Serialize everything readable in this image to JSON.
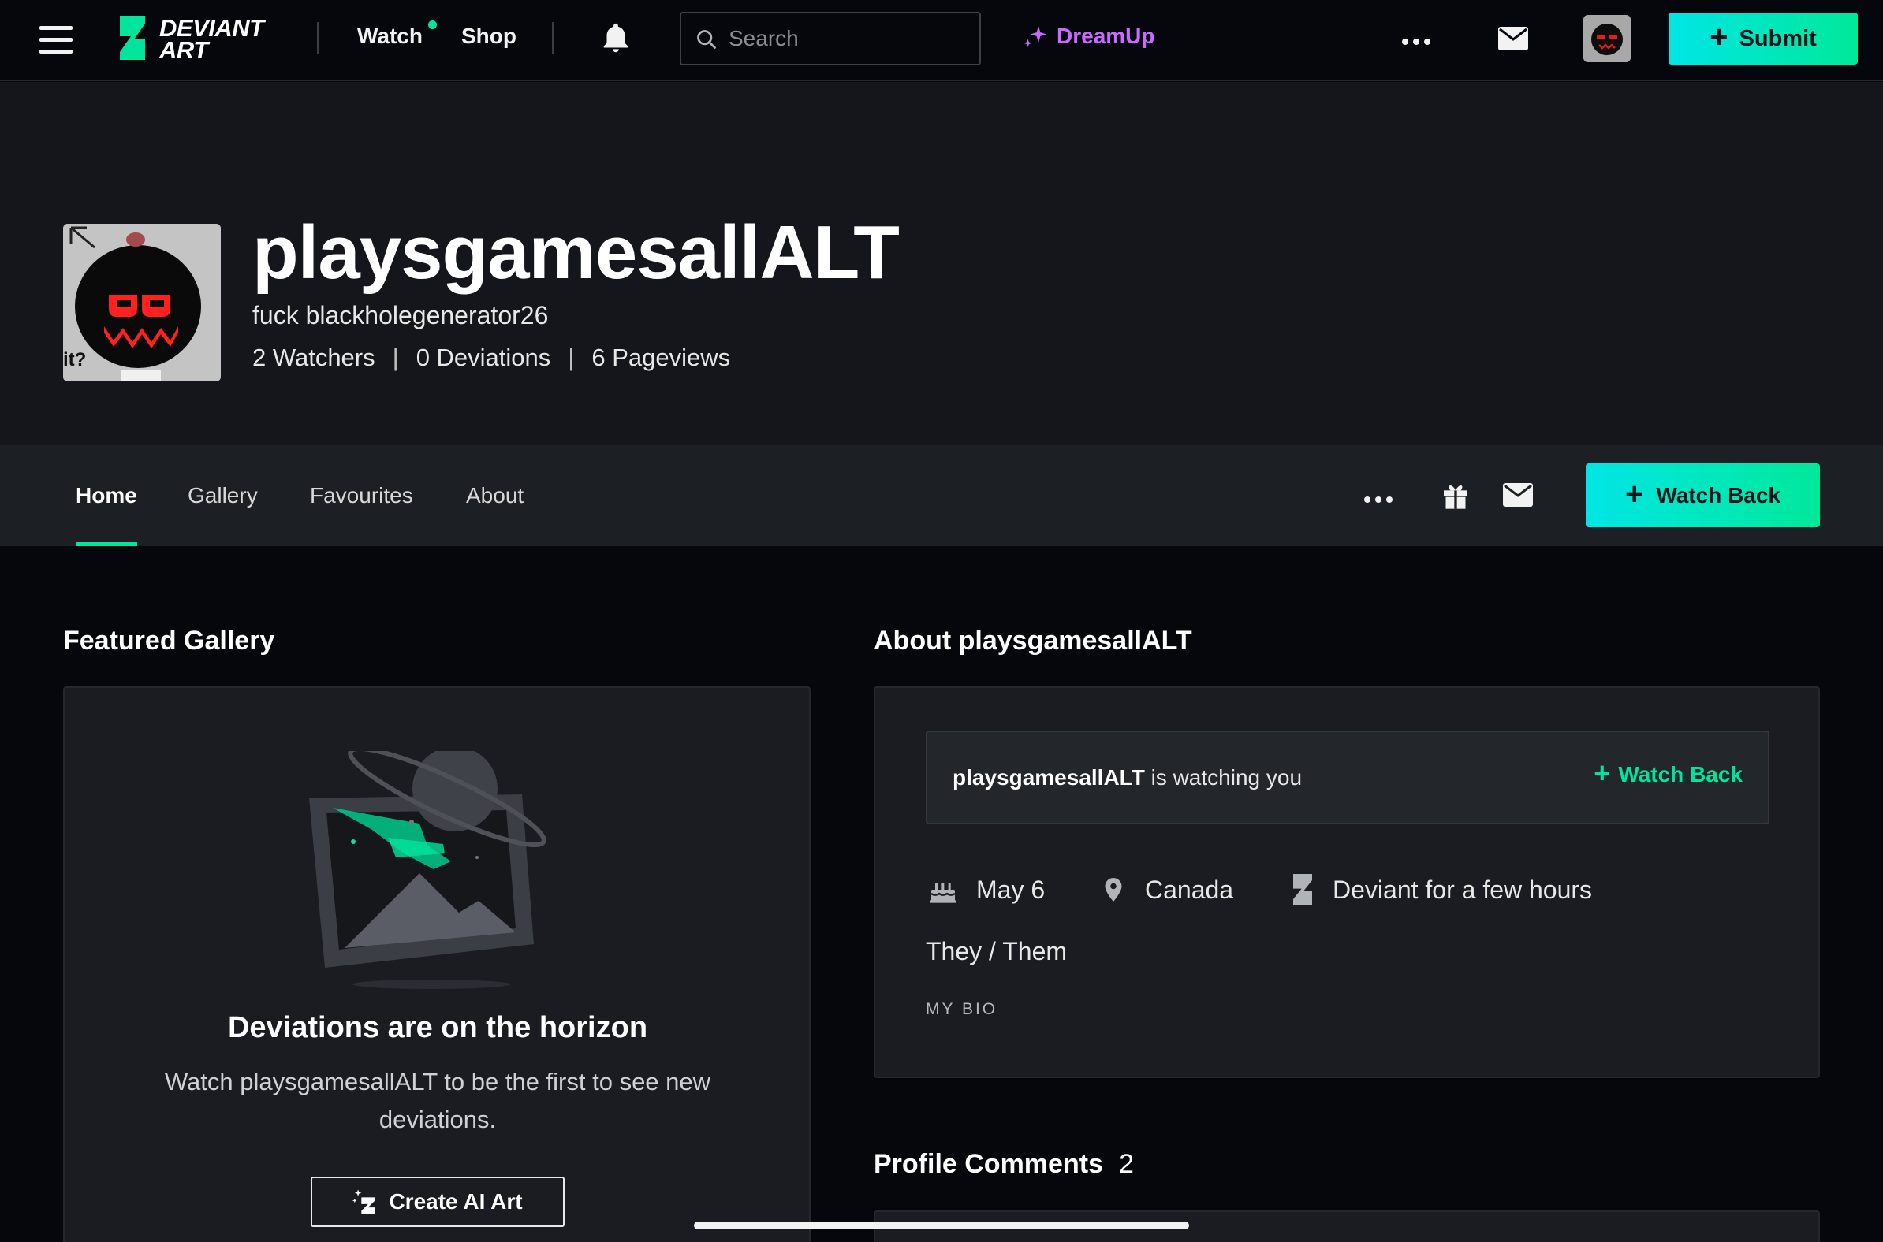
{
  "topbar": {
    "logo_line1": "DEVIANT",
    "logo_line2": "ART",
    "nav": {
      "watch": "Watch",
      "shop": "Shop"
    },
    "search_placeholder": "Search",
    "dreamup": "DreamUp",
    "submit": "Submit"
  },
  "profile": {
    "username": "playsgamesallALT",
    "tagline": "fuck blackholegenerator26",
    "stats": {
      "watchers": "2 Watchers",
      "deviations": "0 Deviations",
      "pageviews": "6 Pageviews",
      "separator": "|"
    }
  },
  "tabs": [
    {
      "label": "Home",
      "active": true
    },
    {
      "label": "Gallery",
      "active": false
    },
    {
      "label": "Favourites",
      "active": false
    },
    {
      "label": "About",
      "active": false
    }
  ],
  "watch_back_button": "Watch Back",
  "featured": {
    "title": "Featured Gallery",
    "empty_title": "Deviations are on the horizon",
    "empty_text": "Watch playsgamesallALT to be the first to see new deviations.",
    "create_button": "Create AI Art"
  },
  "about": {
    "title": "About playsgamesallALT",
    "watching_user": "playsgamesallALT",
    "watching_suffix": " is watching you",
    "watch_back_link": "Watch Back",
    "birthday": "May 6",
    "location": "Canada",
    "deviant_since": "Deviant for a few hours",
    "pronouns": "They / Them",
    "bio_label": "MY BIO"
  },
  "comments": {
    "title": "Profile Comments",
    "count": "2"
  },
  "colors": {
    "accent_green": "#00e59b",
    "accent_cyan": "#00e6e6",
    "dreamup_purple": "#c86aff",
    "background": "#06070d",
    "panel": "#1a1c21"
  },
  "icons": [
    "hamburger-icon",
    "deviantart-logo-icon",
    "bell-icon",
    "search-icon",
    "sparkle-icon",
    "more-icon",
    "mail-icon",
    "gift-icon",
    "plus-icon",
    "cake-icon",
    "location-pin-icon",
    "deviantart-mark-icon"
  ]
}
